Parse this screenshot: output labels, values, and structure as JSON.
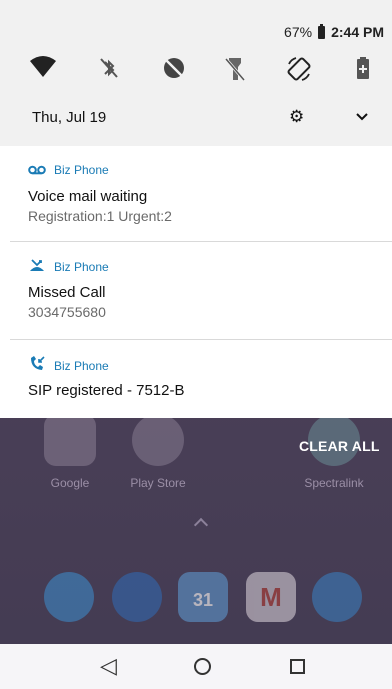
{
  "status_bar": {
    "battery": "67%",
    "time": "2:44 PM"
  },
  "quick_settings": {
    "tiles": [
      {
        "icon": "wifi-icon"
      },
      {
        "icon": "bluetooth-off-icon"
      },
      {
        "icon": "do-not-disturb-off-icon"
      },
      {
        "icon": "flashlight-off-icon"
      },
      {
        "icon": "auto-rotate-icon"
      },
      {
        "icon": "battery-saver-icon"
      }
    ],
    "date": "Thu, Jul 19"
  },
  "notifications": [
    {
      "app": "Biz Phone",
      "icon": "voicemail-icon",
      "title": "Voice mail waiting",
      "text": "Registration:1 Urgent:2"
    },
    {
      "app": "Biz Phone",
      "icon": "missed-call-icon",
      "title": "Missed Call",
      "text": "3034755680"
    },
    {
      "app": "Biz Phone",
      "icon": "call-received-icon",
      "title": "SIP registered - 7512-B",
      "text": ""
    }
  ],
  "clear_all_label": "CLEAR ALL",
  "home": {
    "apps": [
      {
        "label": "Google"
      },
      {
        "label": "Play Store"
      },
      {
        "label": "Spectralink"
      }
    ],
    "calendar_day": "31"
  }
}
